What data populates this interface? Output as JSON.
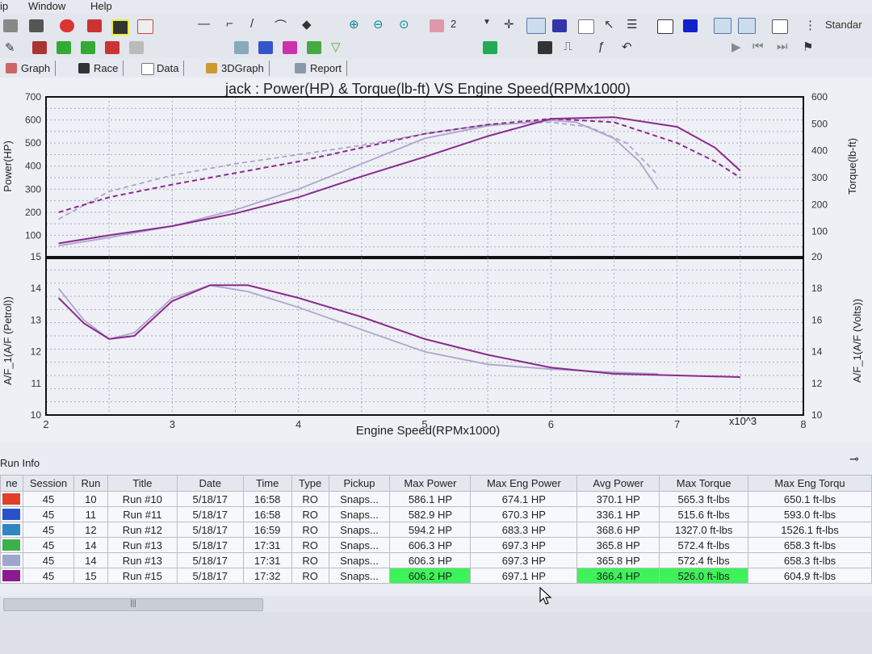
{
  "menu": {
    "items": [
      "ip",
      "Window",
      "Help"
    ]
  },
  "toolbar": {
    "run_count": "2",
    "standard_label": "Standar"
  },
  "tabs": [
    {
      "label": "Graph",
      "icon": "graph-icon"
    },
    {
      "label": "Race",
      "icon": "race-flag-icon"
    },
    {
      "label": "Data",
      "icon": "data-table-icon"
    },
    {
      "label": "3DGraph",
      "icon": "3d-graph-icon"
    },
    {
      "label": "Report",
      "icon": "report-icon"
    }
  ],
  "chart_data": [
    {
      "type": "line",
      "title": "jack   : Power(HP) & Torque(lb-ft) VS Engine Speed(RPMx1000)",
      "ylabel": "Power(HP)",
      "y2label": "Torque(lb-ft)",
      "ylim": [
        0,
        700
      ],
      "y2lim": [
        0,
        600
      ],
      "yticks": [
        "100",
        "200",
        "300",
        "400",
        "500",
        "600",
        "700"
      ],
      "y2ticks": [
        "100",
        "200",
        "300",
        "400",
        "500",
        "600"
      ],
      "xlim": [
        2,
        8
      ],
      "grid": true,
      "series": [
        {
          "axis": "y",
          "color": "#b0a4cc",
          "style": "solid",
          "x": [
            2.1,
            2.5,
            3.0,
            3.5,
            4.0,
            4.5,
            5.0,
            5.5,
            6.0,
            6.2,
            6.5,
            6.7,
            6.85
          ],
          "y": [
            55,
            90,
            140,
            210,
            300,
            410,
            520,
            575,
            598,
            590,
            520,
            420,
            300
          ]
        },
        {
          "axis": "y",
          "color": "#b0a4cc",
          "style": "dashed",
          "x": [
            2.1,
            2.5,
            3.0,
            3.5,
            4.0,
            4.5,
            5.0,
            5.5,
            6.0,
            6.3,
            6.6,
            6.85
          ],
          "y": [
            170,
            290,
            360,
            410,
            450,
            490,
            540,
            580,
            590,
            570,
            500,
            360
          ]
        },
        {
          "axis": "y",
          "color": "#8b2a8f",
          "style": "solid",
          "x": [
            2.1,
            2.5,
            3.0,
            3.5,
            4.0,
            4.5,
            5.0,
            5.5,
            6.0,
            6.5,
            7.0,
            7.3,
            7.5
          ],
          "y": [
            65,
            100,
            140,
            195,
            265,
            355,
            440,
            530,
            605,
            612,
            570,
            480,
            380
          ]
        },
        {
          "axis": "y",
          "color": "#8b2a8f",
          "style": "dashed",
          "x": [
            2.1,
            2.5,
            3.0,
            3.5,
            4.0,
            4.5,
            5.0,
            5.5,
            6.0,
            6.5,
            7.0,
            7.3,
            7.5
          ],
          "y": [
            200,
            265,
            320,
            370,
            420,
            480,
            540,
            580,
            605,
            590,
            500,
            420,
            350
          ]
        }
      ]
    },
    {
      "type": "line",
      "xlabel": "Engine Speed(RPMx1000)",
      "ylabel": "A/F_1(A/F (Petrol))",
      "y2label": "A/F_1(A/F (Volts))",
      "ylim": [
        10,
        15
      ],
      "y2lim": [
        10,
        20
      ],
      "xlim": [
        2,
        8
      ],
      "x_multiplier_label": "x10^3",
      "xticks": [
        "2",
        "3",
        "4",
        "5",
        "6",
        "7",
        "8"
      ],
      "yticks": [
        "10",
        "11",
        "12",
        "13",
        "14",
        "15"
      ],
      "y2ticks": [
        "10",
        "12",
        "14",
        "16",
        "18",
        "20"
      ],
      "grid": true,
      "series": [
        {
          "color": "#b0a4cc",
          "x": [
            2.1,
            2.3,
            2.5,
            2.7,
            3.0,
            3.3,
            3.6,
            4.0,
            4.5,
            5.0,
            5.5,
            6.0,
            6.5,
            6.85
          ],
          "y": [
            14.0,
            13.0,
            12.4,
            12.6,
            13.7,
            14.1,
            13.9,
            13.4,
            12.7,
            12.0,
            11.6,
            11.45,
            11.35,
            11.3
          ]
        },
        {
          "color": "#8b2a8f",
          "x": [
            2.1,
            2.3,
            2.5,
            2.7,
            3.0,
            3.3,
            3.6,
            4.0,
            4.5,
            5.0,
            5.5,
            6.0,
            6.5,
            7.0,
            7.5
          ],
          "y": [
            13.7,
            12.9,
            12.4,
            12.5,
            13.6,
            14.1,
            14.1,
            13.7,
            13.1,
            12.4,
            11.9,
            11.5,
            11.3,
            11.25,
            11.2
          ]
        }
      ]
    }
  ],
  "run_info": {
    "title": "Run Info",
    "columns": [
      "ne",
      "Session",
      "Run",
      "Title",
      "Date",
      "Time",
      "Type",
      "Pickup",
      "Max Power",
      "Max Eng Power",
      "Avg Power",
      "Max Torque",
      "Max Eng Torqu"
    ],
    "rows": [
      {
        "color": "#e0402a",
        "cells": [
          "45",
          "10",
          "Run #10",
          "5/18/17",
          "16:58",
          "RO",
          "Snaps...",
          "586.1 HP",
          "674.1 HP",
          "370.1 HP",
          "565.3 ft-lbs",
          "650.1 ft-lbs"
        ]
      },
      {
        "color": "#2a52c8",
        "cells": [
          "45",
          "11",
          "Run #11",
          "5/18/17",
          "16:58",
          "RO",
          "Snaps...",
          "582.9 HP",
          "670.3 HP",
          "336.1 HP",
          "515.6 ft-lbs",
          "593.0 ft-lbs"
        ]
      },
      {
        "color": "#2f86c0",
        "cells": [
          "45",
          "12",
          "Run #12",
          "5/18/17",
          "16:59",
          "RO",
          "Snaps...",
          "594.2 HP",
          "683.3 HP",
          "368.6 HP",
          "1327.0 ft-lbs",
          "1526.1 ft-lbs"
        ]
      },
      {
        "color": "#3cb04a",
        "cells": [
          "45",
          "14",
          "Run #13",
          "5/18/17",
          "17:31",
          "RO",
          "Snaps...",
          "606.3 HP",
          "697.3 HP",
          "365.8 HP",
          "572.4 ft-lbs",
          "658.3 ft-lbs"
        ]
      },
      {
        "color": "#9ea6cc",
        "cells": [
          "45",
          "14",
          "Run #13",
          "5/18/17",
          "17:31",
          "RO",
          "Snaps...",
          "606.3 HP",
          "697.3 HP",
          "365.8 HP",
          "572.4 ft-lbs",
          "658.3 ft-lbs"
        ]
      },
      {
        "color": "#8b1a8f",
        "cells": [
          "45",
          "15",
          "Run #15",
          "5/18/17",
          "17:32",
          "RO",
          "Snaps...",
          "606.2 HP",
          "697.1 HP",
          "366.4 HP",
          "526.0 ft-lbs",
          "604.9 ft-lbs"
        ],
        "highlight": [
          7,
          9,
          10
        ]
      }
    ]
  }
}
